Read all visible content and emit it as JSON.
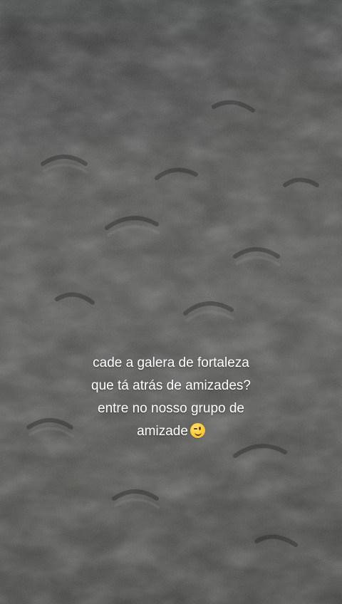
{
  "caption": {
    "line1": "cade a galera de fortaleza",
    "line2": "que tá atrás de amizades?",
    "line3": "entre no nosso grupo de",
    "line4": "amizade",
    "emoji": "winking-face-icon"
  },
  "colors": {
    "sand_dark": "#363838",
    "sand_mid": "#4d4d4a",
    "text": "#ffffff",
    "emoji": "#ffcc33"
  }
}
